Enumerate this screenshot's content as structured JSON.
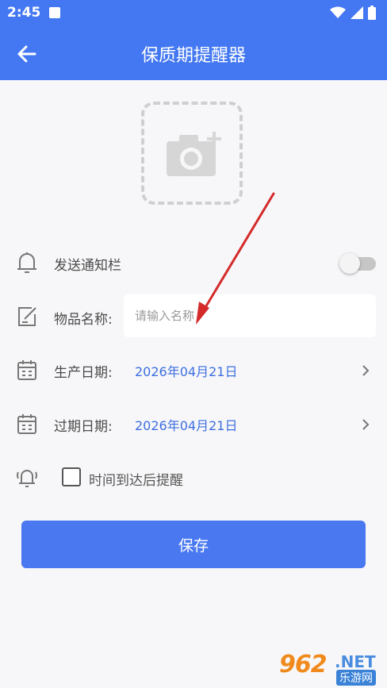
{
  "status_bar": {
    "time": "2:45",
    "icons": [
      "a-notification-icon",
      "wifi-icon",
      "signal-icon",
      "battery-icon"
    ]
  },
  "header": {
    "title": "保质期提醒器",
    "back_icon": "arrow-left-icon",
    "background": "#4478f2"
  },
  "photo": {
    "icon": "camera-add-icon"
  },
  "notify": {
    "label": "发送通知栏",
    "enabled": false
  },
  "item_name": {
    "label": "物品名称:",
    "placeholder": "请输入名称"
  },
  "production_date": {
    "label": "生产日期:",
    "value": "2026年04月21日"
  },
  "expiry_date": {
    "label": "过期日期:",
    "value": "2026年04月21日"
  },
  "remind": {
    "label": "时间到达后提醒",
    "checked": false
  },
  "save": {
    "label": "保存"
  },
  "watermark": {
    "number": "962",
    "suffix": ".NET",
    "site": "乐游网"
  },
  "colors": {
    "accent": "#4478f2",
    "date_text": "#3d6fe0",
    "arrow": "#d42a2a"
  }
}
